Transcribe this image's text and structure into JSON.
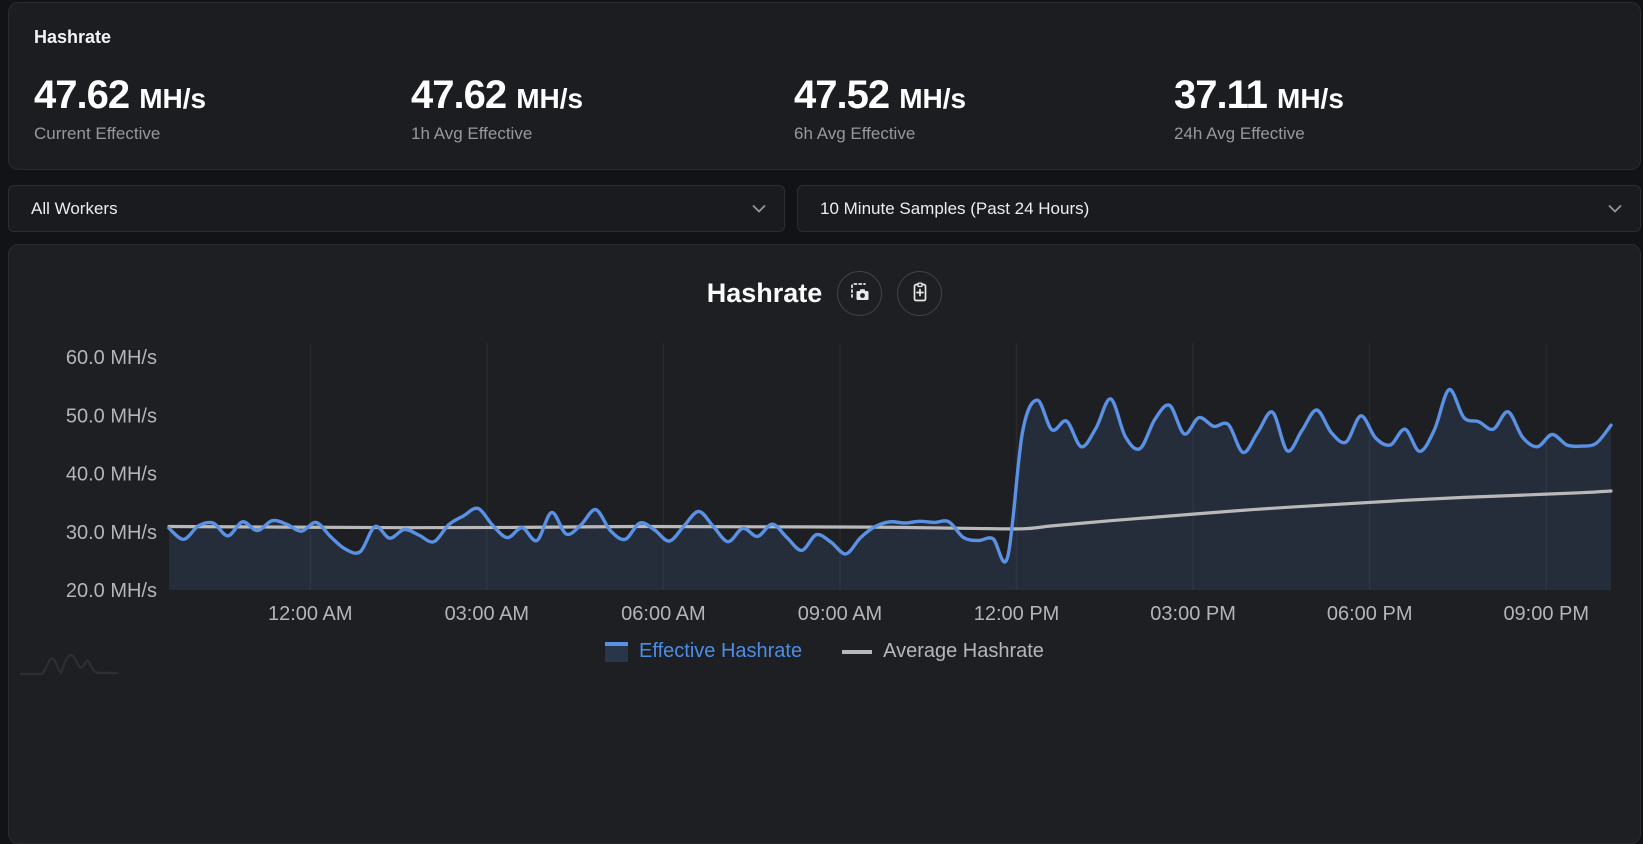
{
  "stats": {
    "title": "Hashrate",
    "cards": [
      {
        "value": "47.62",
        "unit": "MH/s",
        "label": "Current Effective"
      },
      {
        "value": "47.62",
        "unit": "MH/s",
        "label": "1h Avg Effective"
      },
      {
        "value": "47.52",
        "unit": "MH/s",
        "label": "6h Avg Effective"
      },
      {
        "value": "37.11",
        "unit": "MH/s",
        "label": "24h Avg Effective"
      }
    ]
  },
  "filters": {
    "worker_select": {
      "value": "All Workers"
    },
    "sample_select": {
      "value": "10 Minute Samples (Past 24 Hours)"
    }
  },
  "chart_header": {
    "title": "Hashrate",
    "buttons": [
      {
        "name": "screenshot-chart",
        "icon": "camera-capture-icon"
      },
      {
        "name": "add-to-dashboard",
        "icon": "clipboard-plus-icon"
      }
    ]
  },
  "chart_data": {
    "type": "area",
    "title": "Hashrate",
    "x_unit": "hours since window start (window = past 24h, starts ~09:36 PM)",
    "x_range": [
      0,
      24.5
    ],
    "ylim": [
      20,
      63
    ],
    "grid": "vertical-only",
    "legend_position": "bottom",
    "y_ticks": [
      {
        "v": 60,
        "label": "60.0 MH/s"
      },
      {
        "v": 50,
        "label": "50.0 MH/s"
      },
      {
        "v": 40,
        "label": "40.0 MH/s"
      },
      {
        "v": 30,
        "label": "30.0 MH/s"
      },
      {
        "v": 20,
        "label": "20.0 MH/s"
      }
    ],
    "x_ticks": [
      {
        "t": 2.4,
        "label": "12:00 AM"
      },
      {
        "t": 5.4,
        "label": "03:00 AM"
      },
      {
        "t": 8.4,
        "label": "06:00 AM"
      },
      {
        "t": 11.4,
        "label": "09:00 AM"
      },
      {
        "t": 14.4,
        "label": "12:00 PM"
      },
      {
        "t": 17.4,
        "label": "03:00 PM"
      },
      {
        "t": 20.4,
        "label": "06:00 PM"
      },
      {
        "t": 23.4,
        "label": "09:00 PM"
      }
    ],
    "series": [
      {
        "name": "Effective Hashrate",
        "color": "#5b91e4",
        "fill": "rgba(91,145,228,0.12)",
        "t0": 0,
        "dt": 0.25,
        "values": [
          30.6,
          28.7,
          31.0,
          31.5,
          29.3,
          31.7,
          30.2,
          31.9,
          31.3,
          30.1,
          31.6,
          29.1,
          27.0,
          26.6,
          30.9,
          28.9,
          30.4,
          29.4,
          28.3,
          31.2,
          32.7,
          34.0,
          31.1,
          29.0,
          30.7,
          28.5,
          33.3,
          29.6,
          31.2,
          33.8,
          30.2,
          28.7,
          31.5,
          30.3,
          28.4,
          31.0,
          33.5,
          30.9,
          28.3,
          30.6,
          29.2,
          31.3,
          29.0,
          26.8,
          29.5,
          28.2,
          26.2,
          29.0,
          30.9,
          31.7,
          31.5,
          31.8,
          31.6,
          31.7,
          29.0,
          28.5,
          28.8,
          25.7,
          47.0,
          52.6,
          47.5,
          49.0,
          44.6,
          47.8,
          52.8,
          46.3,
          44.3,
          49.3,
          51.7,
          46.8,
          49.6,
          48.1,
          48.4,
          43.6,
          47.1,
          50.5,
          43.9,
          47.4,
          50.9,
          47.0,
          45.4,
          49.9,
          46.1,
          44.9,
          47.6,
          43.8,
          47.5,
          54.4,
          49.6,
          48.9,
          47.6,
          50.6,
          46.2,
          44.6,
          46.7,
          44.9,
          44.7,
          45.2,
          48.3
        ]
      },
      {
        "name": "Average Hashrate",
        "color": "#b9b9b9",
        "points": [
          [
            0,
            30.9
          ],
          [
            2,
            30.8
          ],
          [
            4,
            30.7
          ],
          [
            6,
            30.75
          ],
          [
            8,
            30.9
          ],
          [
            10,
            30.85
          ],
          [
            12,
            30.8
          ],
          [
            13.5,
            30.6
          ],
          [
            14.5,
            30.5
          ],
          [
            15,
            31.0
          ],
          [
            16,
            31.9
          ],
          [
            17,
            32.7
          ],
          [
            18,
            33.5
          ],
          [
            19,
            34.2
          ],
          [
            20,
            34.8
          ],
          [
            21,
            35.4
          ],
          [
            22,
            35.9
          ],
          [
            23,
            36.3
          ],
          [
            24,
            36.7
          ],
          [
            24.5,
            37.0
          ]
        ]
      }
    ]
  },
  "colors": {
    "page_bg": "#121316",
    "panel_bg": "#1c1d20",
    "chart_panel_bg": "#1d1f22",
    "border": "#2a2b2e",
    "gridline": "#27292d",
    "tick_text": "#b3b6b9",
    "effective_blue": "#5b91e4",
    "legend_blue_text": "#4d8de8",
    "average_gray": "#b9b9b9",
    "stat_label_gray": "#96989b"
  }
}
